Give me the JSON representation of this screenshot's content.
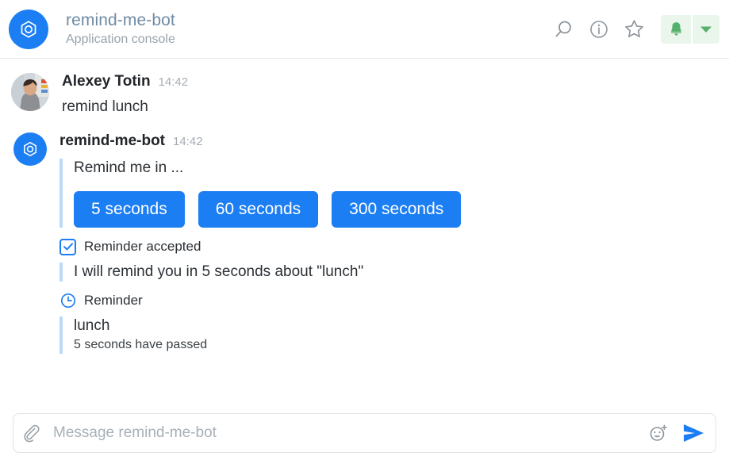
{
  "header": {
    "app_icon": "hexagon-app-icon",
    "title": "remind-me-bot",
    "subtitle": "Application console",
    "actions": [
      {
        "name": "search-icon",
        "label": "Search"
      },
      {
        "name": "info-icon",
        "label": "Info"
      },
      {
        "name": "star-icon",
        "label": "Favorite"
      }
    ],
    "notification": {
      "bell_icon": "bell-icon",
      "caret_icon": "chevron-down-icon",
      "background_color": "#eaf6ec",
      "icon_color": "#54b06a"
    },
    "accent_color": "#1c7ef3",
    "title_color": "#6f8ba4"
  },
  "messages": [
    {
      "author": "Alexey Totin",
      "time": "14:42",
      "avatar": "user-photo-avatar",
      "text": "remind lunch"
    },
    {
      "author": "remind-me-bot",
      "time": "14:42",
      "avatar": "hexagon-app-icon",
      "quote_prompt": "Remind me in ...",
      "buttons": [
        {
          "label": "5 seconds"
        },
        {
          "label": "60 seconds"
        },
        {
          "label": "300 seconds"
        }
      ],
      "accepted_status": "Reminder accepted",
      "accepted_icon": "checkbox-checked-icon",
      "accepted_text": "I will remind you in 5 seconds about \"lunch\"",
      "reminder_status": "Reminder",
      "reminder_icon": "clock-icon",
      "reminder_title": "lunch",
      "reminder_sub": "5 seconds have passed"
    }
  ],
  "composer": {
    "attach_icon": "paperclip-icon",
    "placeholder": "Message remind-me-bot",
    "value": "",
    "emoji_icon": "emoji-add-icon",
    "send_icon": "send-icon",
    "send_color": "#1c7ef3"
  }
}
